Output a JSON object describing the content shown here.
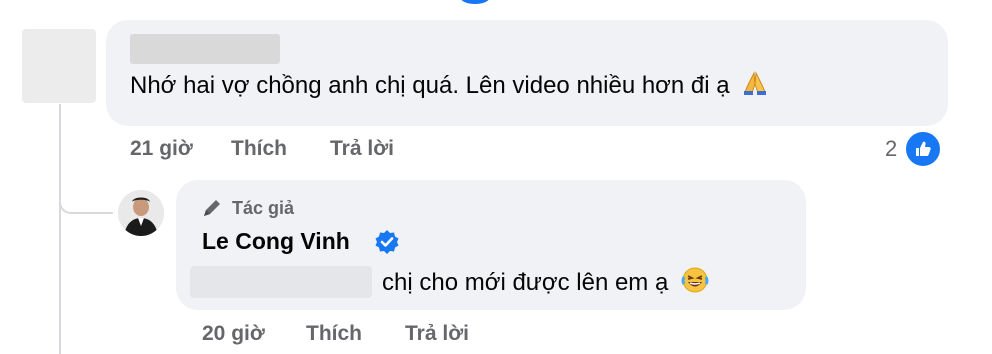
{
  "comment": {
    "text": "Nhớ hai vợ chồng anh chị quá. Lên video nhiều hơn đi ạ",
    "emoji_icon": "folded-hands-icon",
    "time": "21 giờ",
    "like_label": "Thích",
    "reply_label": "Trả lời",
    "reaction_count": "2",
    "reaction_icon": "like-icon"
  },
  "reply": {
    "author_badge": "Tác giả",
    "author_badge_icon": "pen-icon",
    "name": "Le Cong Vinh",
    "verified_icon": "verified-badge-icon",
    "text": "chị cho mới được lên em ạ",
    "emoji_icon": "laughing-tears-icon",
    "time": "20 giờ",
    "like_label": "Thích",
    "reply_label": "Trả lời"
  },
  "colors": {
    "bubble": "#f0f2f5",
    "secondary_text": "#65676b",
    "brand_blue": "#1877f2"
  }
}
